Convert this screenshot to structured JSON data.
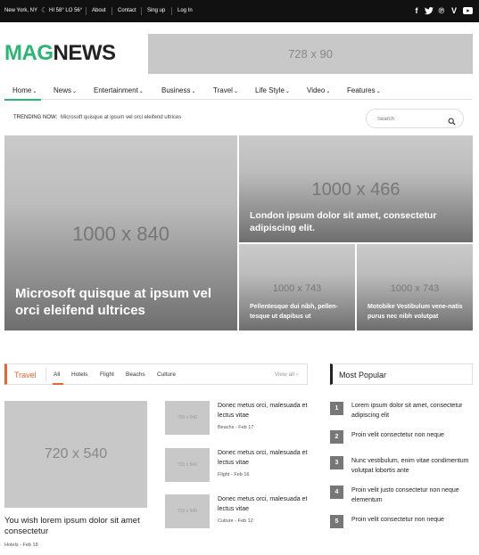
{
  "topbar": {
    "location": "New York, NY",
    "weather_icon": "moon-icon",
    "temperature": "HI 58° LO 56°",
    "links": [
      "About",
      "Contact",
      "Sing up",
      "Log In"
    ],
    "social": [
      "facebook-icon",
      "twitter-icon",
      "pinterest-icon",
      "vimeo-icon",
      "youtube-icon"
    ]
  },
  "header": {
    "logo_part1": "MAG",
    "logo_part2": "NEWS",
    "ad_label": "728 x 90"
  },
  "nav": {
    "items": [
      "Home",
      "News",
      "Entertainment",
      "Business",
      "Travel",
      "Life Style",
      "Video",
      "Features"
    ],
    "active_index": 0
  },
  "trending": {
    "label": "TRENDING NOW:",
    "text": "Microsoft quisque at ipsum vel orci eleifend ultrices",
    "search_placeholder": "Search"
  },
  "hero": {
    "main": {
      "placeholder": "1000 x 840",
      "caption": "Microsoft quisque at ipsum vel orci eleifend ultrices"
    },
    "top_right": {
      "placeholder": "1000 x 466",
      "caption": "London ipsum dolor sit amet, consectetur adipiscing elit."
    },
    "bottom_left": {
      "placeholder": "1000 x 743",
      "caption": "Pellentesque dui nibh, pellen-tesque ut dapibus ut"
    },
    "bottom_right": {
      "placeholder": "1000 x 743",
      "caption": "Motobike Vestibulum vene-natis purus nec nibh volutpat"
    }
  },
  "travel": {
    "title": "Travel",
    "tabs": [
      "All",
      "Hotels",
      "Flight",
      "Beachs",
      "Culture"
    ],
    "view_all": "View all ›",
    "featured": {
      "placeholder": "720 x 540",
      "title": "You wish lorem ipsum dolor sit amet consectetur",
      "category": "Hotels",
      "date": "Feb 18"
    },
    "list": [
      {
        "placeholder": "720 x 540",
        "title": "Donec metus orci, malesuada et lectus vitae",
        "category": "Beachs",
        "date": "Feb 17"
      },
      {
        "placeholder": "720 x 540",
        "title": "Donec metus orci, malesuada et lectus vitae",
        "category": "Flight",
        "date": "Feb 16"
      },
      {
        "placeholder": "720 x 540",
        "title": "Donec metus orci, malesuada et lectus vitae",
        "category": "Culture",
        "date": "Feb 12"
      }
    ]
  },
  "popular": {
    "title": "Most Popular",
    "items": [
      {
        "num": "1",
        "text": "Lorem ipsum dolor sit amet, consectetur adipiscing elit"
      },
      {
        "num": "2",
        "text": "Proin velit consectetur non neque"
      },
      {
        "num": "3",
        "text": "Nunc vestibulum, enim vitae condimentum volutpat lobortis ante"
      },
      {
        "num": "4",
        "text": "Proin velit justo consectetur non neque elementum"
      },
      {
        "num": "5",
        "text": "Proin velit consectetur non neque"
      }
    ]
  },
  "meta_separator": "-",
  "colors": {
    "brand_green": "#2bb673",
    "travel_accent": "#e86531",
    "topbar_bg": "#111111"
  }
}
